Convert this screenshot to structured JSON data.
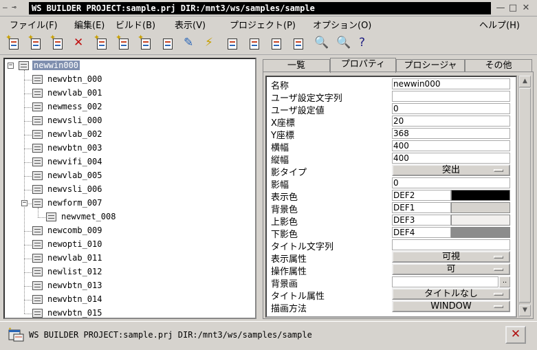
{
  "window": {
    "sys_icons": "— ⊸",
    "title": "WS BUILDER PROJECT:sample.prj DIR:/mnt3/ws/samples/sample",
    "buttons": {
      "minimize": "—",
      "maximize": "□",
      "close": "✕"
    }
  },
  "menu": {
    "items": [
      {
        "label": "ファイル(F)"
      },
      {
        "label": "編集(E)"
      },
      {
        "label": "ビルド(B)"
      },
      {
        "label": "表示(V)"
      },
      {
        "label": "プロジェクト(P)"
      },
      {
        "label": "オプション(O)"
      },
      {
        "label": "ヘルプ(H)"
      }
    ]
  },
  "toolbar": {
    "icons": [
      "new-window-icon",
      "new-dialog-icon",
      "new-form-icon",
      "delete-icon",
      "new-menu-icon",
      "new-list-icon",
      "new-item-icon",
      "stack-icon",
      "edit-icon",
      "lightning-icon",
      "build-icon",
      "save-icon",
      "folder-icon",
      "properties-icon",
      "zoom-in-icon",
      "zoom-fit-icon",
      "help-book-icon"
    ]
  },
  "tree": {
    "items": [
      {
        "label": "newwin000",
        "level": 0,
        "selected": true
      },
      {
        "label": "newvbtn_000",
        "level": 1
      },
      {
        "label": "newvlab_001",
        "level": 1
      },
      {
        "label": "newmess_002",
        "level": 1
      },
      {
        "label": "newvsli_000",
        "level": 1
      },
      {
        "label": "newvlab_002",
        "level": 1
      },
      {
        "label": "newvbtn_003",
        "level": 1
      },
      {
        "label": "newvifi_004",
        "level": 1
      },
      {
        "label": "newvlab_005",
        "level": 1
      },
      {
        "label": "newvsli_006",
        "level": 1
      },
      {
        "label": "newform_007",
        "level": 1
      },
      {
        "label": "newvmet_008",
        "level": 2
      },
      {
        "label": "newcomb_009",
        "level": 1
      },
      {
        "label": "newopti_010",
        "level": 1
      },
      {
        "label": "newvlab_011",
        "level": 1
      },
      {
        "label": "newlist_012",
        "level": 1
      },
      {
        "label": "newvbtn_013",
        "level": 1
      },
      {
        "label": "newvbtn_014",
        "level": 1
      },
      {
        "label": "newvbtn_015",
        "level": 1
      }
    ]
  },
  "tabs": [
    {
      "label": "一覧"
    },
    {
      "label": "プロパティ",
      "active": true
    },
    {
      "label": "プロシージャ"
    },
    {
      "label": "その他"
    }
  ],
  "properties": [
    {
      "name": "名称",
      "kind": "text",
      "value": "newwin000"
    },
    {
      "name": "ユーザ設定文字列",
      "kind": "text",
      "value": ""
    },
    {
      "name": "ユーザ設定値",
      "kind": "text",
      "value": "0"
    },
    {
      "name": "X座標",
      "kind": "text",
      "value": "20"
    },
    {
      "name": "Y座標",
      "kind": "text",
      "value": "368"
    },
    {
      "name": "横幅",
      "kind": "text",
      "value": "400"
    },
    {
      "name": "縦幅",
      "kind": "text",
      "value": "400"
    },
    {
      "name": "影タイプ",
      "kind": "select",
      "value": "突出"
    },
    {
      "name": "影幅",
      "kind": "text",
      "value": "0"
    },
    {
      "name": "表示色",
      "kind": "color",
      "value": "DEF2",
      "color": "#000000"
    },
    {
      "name": "背景色",
      "kind": "color",
      "value": "DEF1",
      "color": "#d6d3ce"
    },
    {
      "name": "上影色",
      "kind": "color",
      "value": "DEF3",
      "color": "#f2f0ee"
    },
    {
      "name": "下影色",
      "kind": "color",
      "value": "DEF4",
      "color": "#8c8c8c"
    },
    {
      "name": "タイトル文字列",
      "kind": "text",
      "value": ""
    },
    {
      "name": "表示属性",
      "kind": "select",
      "value": "可視"
    },
    {
      "name": "操作属性",
      "kind": "select",
      "value": "可"
    },
    {
      "name": "背景画",
      "kind": "file",
      "value": "",
      "button": ".."
    },
    {
      "name": "タイトル属性",
      "kind": "select",
      "value": "タイトルなし"
    },
    {
      "name": "描画方法",
      "kind": "select",
      "value": "WINDOW"
    }
  ],
  "scrollbar": {
    "up": "▲",
    "down": "▼"
  },
  "status": {
    "text": "WS BUILDER PROJECT:sample.prj DIR:/mnt3/ws/samples/sample",
    "close_label": "✕"
  }
}
